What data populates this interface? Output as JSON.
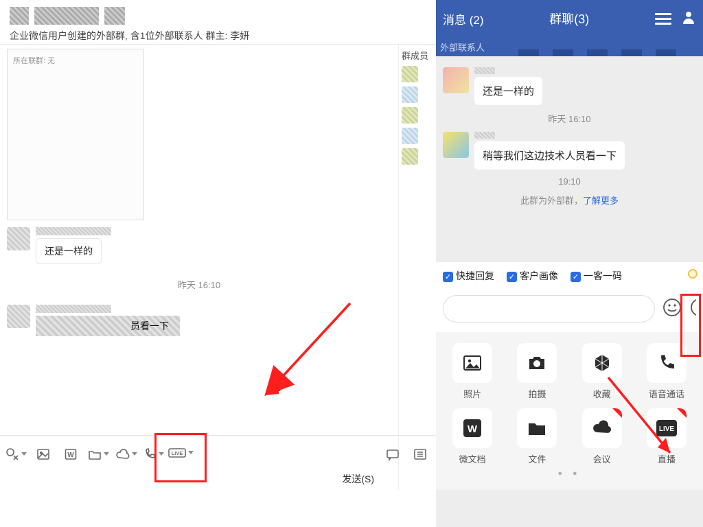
{
  "left": {
    "subtitle": "企业微信用户创建的外部群, 含1位外部联系人 群主: 李妍",
    "panel_note": "所在联群: 无",
    "members_title": "群成员",
    "msg1": "还是一样的",
    "time1": "昨天 16:10",
    "msg2_tail": "员看一下",
    "send_hint": "发送(S)"
  },
  "right": {
    "tab_left": "消息 (2)",
    "tab_center": "群聊(3)",
    "band_text": "外部联系人",
    "msg1": "还是一样的",
    "time1": "昨天 16:10",
    "msg2": "稍等我们这边技术人员看一下",
    "time2": "19:10",
    "ext_note_a": "此群为外部群，",
    "ext_note_b": "了解更多",
    "quick1": "快捷回复",
    "quick2": "客户画像",
    "quick3": "一客一码",
    "grid": {
      "photo": "照片",
      "shoot": "拍摄",
      "fav": "收藏",
      "voice": "语音通话",
      "wdoc": "微文档",
      "file": "文件",
      "meet": "会议",
      "live": "直播"
    }
  },
  "icons": {
    "scissors": "scissors",
    "image": "image",
    "wdoc": "W",
    "folder": "folder",
    "cloud": "cloud",
    "phone": "phone",
    "live": "LIVE",
    "callout": "callout",
    "list": "list",
    "camera": "camera",
    "cube": "cube",
    "handset": "handset",
    "folder2": "folder",
    "cloud2": "cloud"
  }
}
